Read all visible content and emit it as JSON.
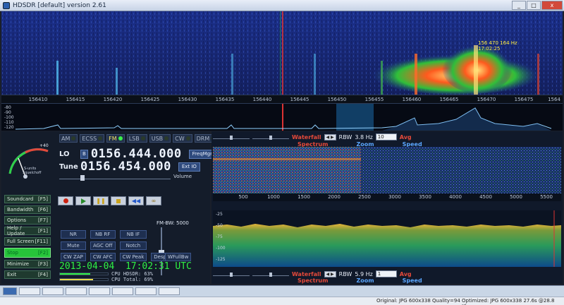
{
  "window": {
    "title": "HDSDR [default]  version 2.61",
    "controls": [
      "_",
      "□",
      "x"
    ]
  },
  "top_scale": {
    "ticks": [
      "156410",
      "156415",
      "156420",
      "156425",
      "156430",
      "156435",
      "156440",
      "156445",
      "156450",
      "156455",
      "156460",
      "156465",
      "156470",
      "156475",
      "1564"
    ],
    "marker_freq": "156 470 164 Hz",
    "marker_time": "17:02:25"
  },
  "top_spectrum": {
    "db_ticks": [
      "-80",
      "-90",
      "-100",
      "-110",
      "-120"
    ]
  },
  "smeter": {
    "scale": "+40",
    "units": "S-units",
    "squelch": "Squelchoff"
  },
  "modes": [
    {
      "label": "AM",
      "active": false
    },
    {
      "label": "ECSS",
      "active": false
    },
    {
      "label": "FM",
      "active": true
    },
    {
      "label": "LSB",
      "active": false
    },
    {
      "label": "USB",
      "active": false
    },
    {
      "label": "CW",
      "active": false
    },
    {
      "label": "DRM",
      "active": false
    }
  ],
  "lo": {
    "label": "LO",
    "badge": "B",
    "value": "0156.444.000",
    "button": "FreqMgr"
  },
  "tune": {
    "label": "Tune",
    "value": "0156.454.000",
    "button": "Ext IO"
  },
  "volume_label": "Volume",
  "side_buttons": [
    {
      "label": "Soundcard",
      "key": "[F5]"
    },
    {
      "label": "Bandwidth",
      "key": "[F6]"
    },
    {
      "label": "Options",
      "key": "[F7]"
    },
    {
      "label": "Help / Update",
      "key": "[F1]"
    },
    {
      "label": "Full Screen",
      "key": "[F11]"
    },
    {
      "label": "Stop",
      "key": "[F2]"
    },
    {
      "label": "Minimize",
      "key": "[F3]"
    },
    {
      "label": "Exit",
      "key": "[F4]"
    }
  ],
  "dsp_buttons": [
    "NR",
    "NB RF",
    "NB IF",
    "Mute",
    "AGC Off",
    "Notch",
    "CW ZAP",
    "CW AFC",
    "CW Peak",
    "Despread",
    "WFullBw"
  ],
  "fm_bw": "FM-BW: 5000",
  "date": "2013-04-04",
  "time": "17:02:31 UTC",
  "cpu": {
    "hdsdr_label": "CPU HDSDR: 63%",
    "hdsdr": 63,
    "total_label": "CPU Total: 69%",
    "total": 69
  },
  "right_top": {
    "waterfall": "Waterfall",
    "spectrum": "Spectrum",
    "rbw": "RBW",
    "rbw_val": "3.8 Hz",
    "select": "10",
    "avg": "Avg",
    "zoom": "Zoom",
    "speed": "Speed"
  },
  "audio_scale": [
    "500",
    "1000",
    "1500",
    "2000",
    "2500",
    "3000",
    "3500",
    "4000",
    "4500",
    "5000",
    "5500"
  ],
  "audio_db": [
    "-25",
    "-50",
    "-75",
    "-100",
    "-125"
  ],
  "right_bottom": {
    "waterfall": "Waterfall",
    "spectrum": "Spectrum",
    "rbw": "RBW",
    "rbw_val": "5.9 Hz",
    "select": "1",
    "avg": "Avg",
    "zoom": "Zoom",
    "speed": "Speed"
  },
  "status": {
    "left": "Original: JPG 600x338  Quality=94",
    "right": "Optimized: JPG 600x338  27.6s @28.8 Kbps"
  }
}
